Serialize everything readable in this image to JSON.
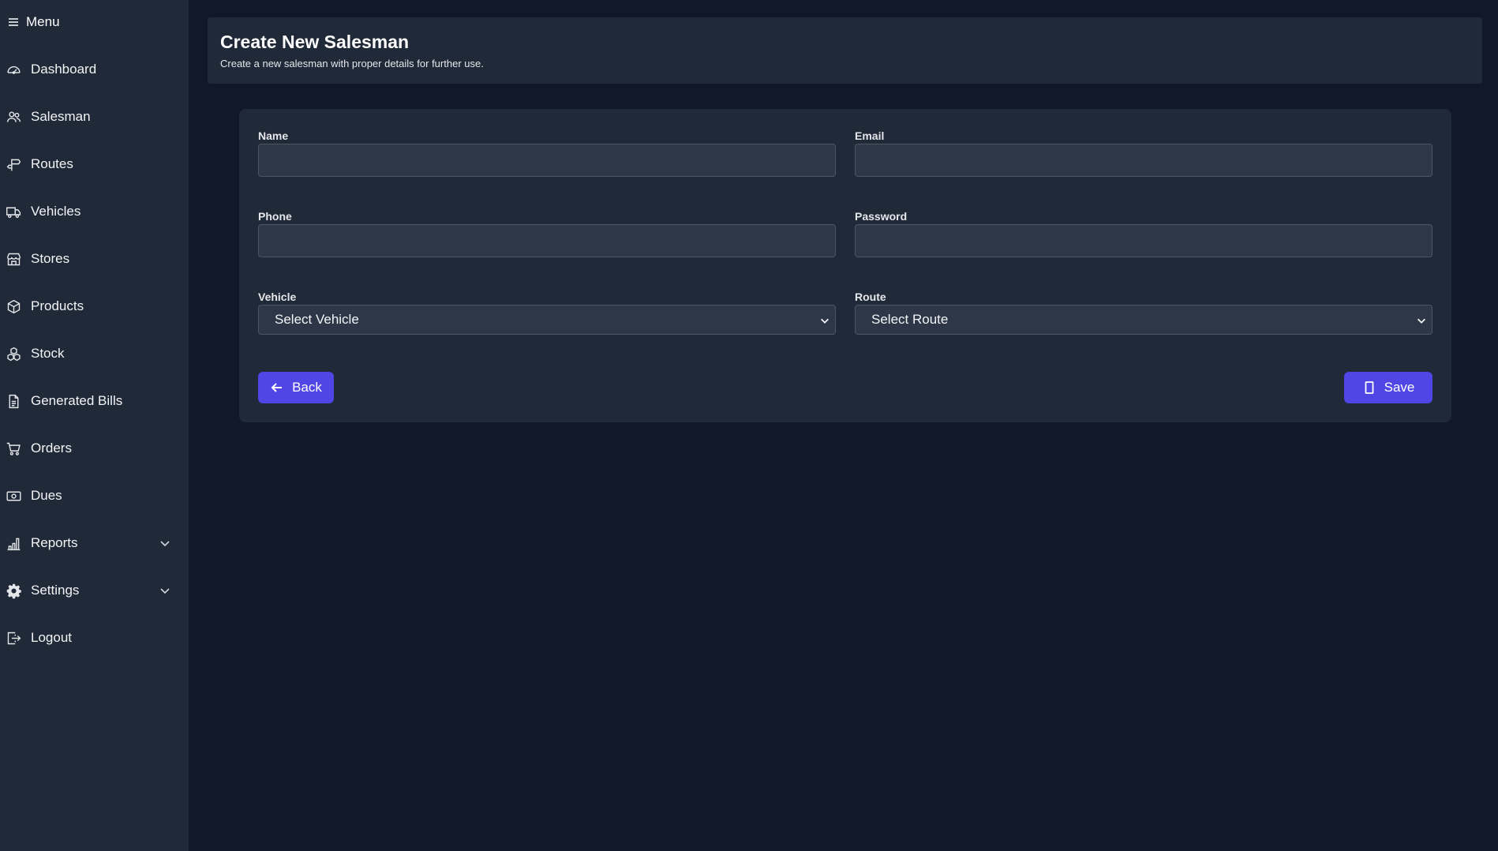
{
  "sidebar": {
    "menu_label": "Menu",
    "items": [
      {
        "label": "Dashboard",
        "icon": "gauge-icon"
      },
      {
        "label": "Salesman",
        "icon": "users-icon"
      },
      {
        "label": "Routes",
        "icon": "signpost-icon"
      },
      {
        "label": "Vehicles",
        "icon": "truck-icon"
      },
      {
        "label": "Stores",
        "icon": "store-icon"
      },
      {
        "label": "Products",
        "icon": "box-icon"
      },
      {
        "label": "Stock",
        "icon": "boxes-icon"
      },
      {
        "label": "Generated Bills",
        "icon": "document-icon"
      },
      {
        "label": "Orders",
        "icon": "cart-icon"
      },
      {
        "label": "Dues",
        "icon": "cash-icon"
      },
      {
        "label": "Reports",
        "icon": "bar-chart-icon"
      },
      {
        "label": "Settings",
        "icon": "gear-icon"
      },
      {
        "label": "Logout",
        "icon": "logout-icon"
      }
    ]
  },
  "header": {
    "title": "Create New Salesman",
    "subtitle": "Create a new salesman with proper details for further use."
  },
  "form": {
    "name_label": "Name",
    "name_value": "",
    "email_label": "Email",
    "email_value": "",
    "phone_label": "Phone",
    "phone_value": "",
    "password_label": "Password",
    "password_value": "",
    "vehicle_label": "Vehicle",
    "vehicle_selected": "Select Vehicle",
    "route_label": "Route",
    "route_selected": "Select Route",
    "back_label": "Back",
    "save_label": "Save"
  },
  "colors": {
    "background": "#111827",
    "panel": "#1f2937",
    "accent": "#4f46e5"
  }
}
